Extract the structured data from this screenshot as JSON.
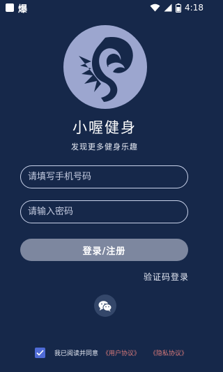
{
  "status_bar": {
    "notification_text": "爆",
    "time": "4:18",
    "battery_level": 0.6
  },
  "app": {
    "title": "小喔健身",
    "subtitle": "发现更多健身乐趣"
  },
  "form": {
    "phone_placeholder": "请填写手机号码",
    "password_placeholder": "请输入密码",
    "login_button": "登录/注册",
    "code_login": "验证码登录"
  },
  "agreement": {
    "checked": true,
    "text": "我已阅读并同意",
    "user_agreement": "《用户协议》",
    "privacy_policy": "《隐私协议》"
  },
  "colors": {
    "background": "#16284a",
    "logo": "#9ca6cf",
    "button": "#7d879f",
    "link": "#d97a7a",
    "checkbox": "#4f6bd6"
  }
}
